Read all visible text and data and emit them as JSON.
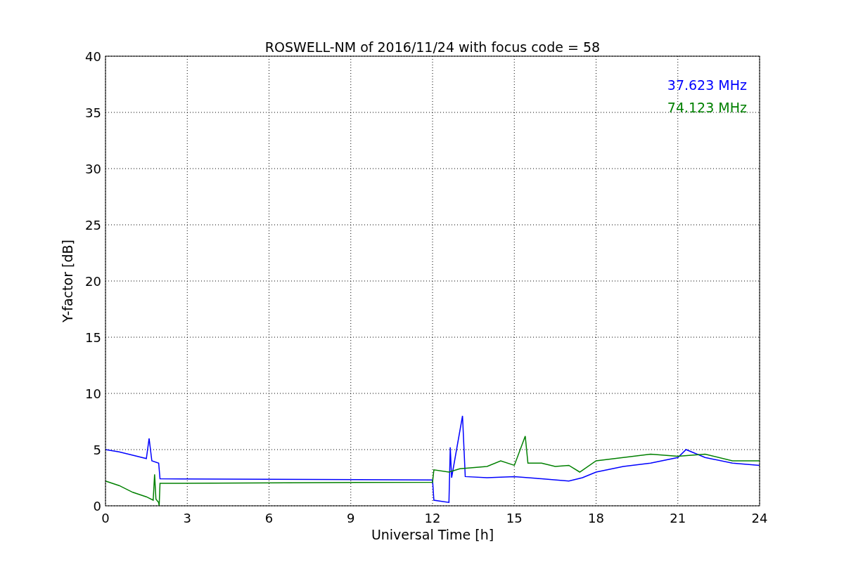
{
  "chart_data": {
    "type": "line",
    "title": "ROSWELL-NM of 2016/11/24 with focus code = 58",
    "xlabel": "Universal Time [h]",
    "ylabel": "Y-factor [dB]",
    "xlim": [
      0,
      24
    ],
    "ylim": [
      0,
      40
    ],
    "grid": true,
    "xticks": [
      0,
      3,
      6,
      9,
      12,
      15,
      18,
      21,
      24
    ],
    "yticks": [
      0,
      5,
      10,
      15,
      20,
      25,
      30,
      35,
      40
    ],
    "series": [
      {
        "name": "37.623 MHz",
        "color": "#0000ff",
        "x": [
          0,
          0.5,
          1,
          1.5,
          1.6,
          1.7,
          1.95,
          2.0,
          12.0,
          12.05,
          12.6,
          12.65,
          12.7,
          13.1,
          13.2,
          14,
          15,
          16,
          17,
          17.5,
          18,
          19,
          20,
          21,
          21.3,
          22,
          23,
          24
        ],
        "values": [
          5,
          4.8,
          4.5,
          4.2,
          6.0,
          4.0,
          3.8,
          2.4,
          2.3,
          0.5,
          0.3,
          5.2,
          2.5,
          8.0,
          2.6,
          2.5,
          2.6,
          2.4,
          2.2,
          2.5,
          3.0,
          3.5,
          3.8,
          4.3,
          5.0,
          4.3,
          3.8,
          3.6
        ]
      },
      {
        "name": "74.123 MHz",
        "color": "#008000",
        "x": [
          0,
          0.5,
          1,
          1.5,
          1.75,
          1.8,
          1.85,
          1.95,
          1.97,
          2.0,
          12.0,
          12.05,
          12.6,
          13,
          14,
          14.5,
          15,
          15.4,
          15.5,
          16,
          16.5,
          17,
          17.4,
          18,
          19,
          20,
          21,
          22,
          23,
          24
        ],
        "values": [
          2.2,
          1.8,
          1.2,
          0.8,
          0.5,
          2.8,
          0.6,
          0.3,
          0.0,
          2.0,
          2.1,
          3.2,
          3.0,
          3.3,
          3.5,
          4.0,
          3.6,
          6.2,
          3.8,
          3.8,
          3.5,
          3.6,
          3.0,
          4.0,
          4.3,
          4.6,
          4.4,
          4.6,
          4.0,
          4.0
        ]
      }
    ]
  }
}
